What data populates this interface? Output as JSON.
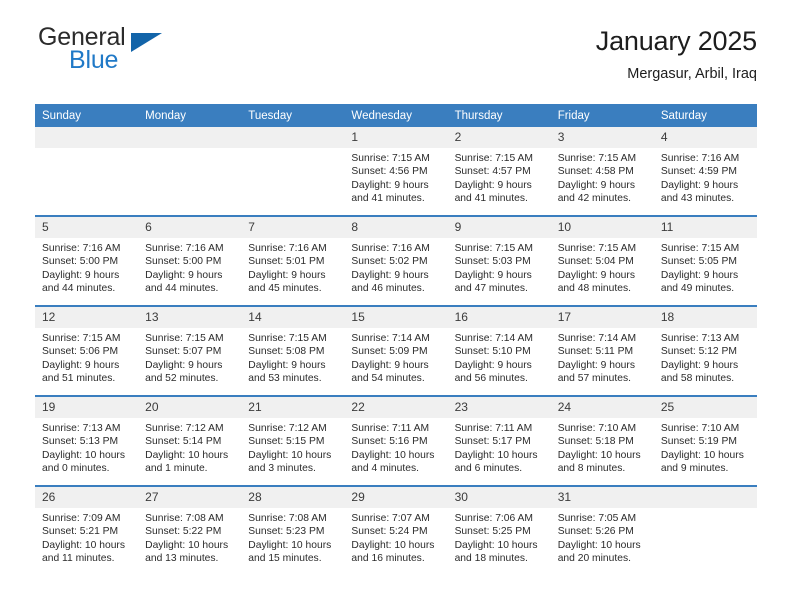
{
  "brand": {
    "name_top": "General",
    "name_bottom": "Blue"
  },
  "header": {
    "title": "January 2025",
    "location": "Mergasur, Arbil, Iraq"
  },
  "colors": {
    "header_blue": "#3a7ebf",
    "brand_blue": "#2079c7",
    "triangle_blue": "#1264a9",
    "daynum_band": "#f0f0f0"
  },
  "weekdays": [
    "Sunday",
    "Monday",
    "Tuesday",
    "Wednesday",
    "Thursday",
    "Friday",
    "Saturday"
  ],
  "weeks": [
    [
      {
        "day": "",
        "empty": true
      },
      {
        "day": "",
        "empty": true
      },
      {
        "day": "",
        "empty": true
      },
      {
        "day": "1",
        "sunrise": "Sunrise: 7:15 AM",
        "sunset": "Sunset: 4:56 PM",
        "daylight1": "Daylight: 9 hours",
        "daylight2": "and 41 minutes."
      },
      {
        "day": "2",
        "sunrise": "Sunrise: 7:15 AM",
        "sunset": "Sunset: 4:57 PM",
        "daylight1": "Daylight: 9 hours",
        "daylight2": "and 41 minutes."
      },
      {
        "day": "3",
        "sunrise": "Sunrise: 7:15 AM",
        "sunset": "Sunset: 4:58 PM",
        "daylight1": "Daylight: 9 hours",
        "daylight2": "and 42 minutes."
      },
      {
        "day": "4",
        "sunrise": "Sunrise: 7:16 AM",
        "sunset": "Sunset: 4:59 PM",
        "daylight1": "Daylight: 9 hours",
        "daylight2": "and 43 minutes."
      }
    ],
    [
      {
        "day": "5",
        "sunrise": "Sunrise: 7:16 AM",
        "sunset": "Sunset: 5:00 PM",
        "daylight1": "Daylight: 9 hours",
        "daylight2": "and 44 minutes."
      },
      {
        "day": "6",
        "sunrise": "Sunrise: 7:16 AM",
        "sunset": "Sunset: 5:00 PM",
        "daylight1": "Daylight: 9 hours",
        "daylight2": "and 44 minutes."
      },
      {
        "day": "7",
        "sunrise": "Sunrise: 7:16 AM",
        "sunset": "Sunset: 5:01 PM",
        "daylight1": "Daylight: 9 hours",
        "daylight2": "and 45 minutes."
      },
      {
        "day": "8",
        "sunrise": "Sunrise: 7:16 AM",
        "sunset": "Sunset: 5:02 PM",
        "daylight1": "Daylight: 9 hours",
        "daylight2": "and 46 minutes."
      },
      {
        "day": "9",
        "sunrise": "Sunrise: 7:15 AM",
        "sunset": "Sunset: 5:03 PM",
        "daylight1": "Daylight: 9 hours",
        "daylight2": "and 47 minutes."
      },
      {
        "day": "10",
        "sunrise": "Sunrise: 7:15 AM",
        "sunset": "Sunset: 5:04 PM",
        "daylight1": "Daylight: 9 hours",
        "daylight2": "and 48 minutes."
      },
      {
        "day": "11",
        "sunrise": "Sunrise: 7:15 AM",
        "sunset": "Sunset: 5:05 PM",
        "daylight1": "Daylight: 9 hours",
        "daylight2": "and 49 minutes."
      }
    ],
    [
      {
        "day": "12",
        "sunrise": "Sunrise: 7:15 AM",
        "sunset": "Sunset: 5:06 PM",
        "daylight1": "Daylight: 9 hours",
        "daylight2": "and 51 minutes."
      },
      {
        "day": "13",
        "sunrise": "Sunrise: 7:15 AM",
        "sunset": "Sunset: 5:07 PM",
        "daylight1": "Daylight: 9 hours",
        "daylight2": "and 52 minutes."
      },
      {
        "day": "14",
        "sunrise": "Sunrise: 7:15 AM",
        "sunset": "Sunset: 5:08 PM",
        "daylight1": "Daylight: 9 hours",
        "daylight2": "and 53 minutes."
      },
      {
        "day": "15",
        "sunrise": "Sunrise: 7:14 AM",
        "sunset": "Sunset: 5:09 PM",
        "daylight1": "Daylight: 9 hours",
        "daylight2": "and 54 minutes."
      },
      {
        "day": "16",
        "sunrise": "Sunrise: 7:14 AM",
        "sunset": "Sunset: 5:10 PM",
        "daylight1": "Daylight: 9 hours",
        "daylight2": "and 56 minutes."
      },
      {
        "day": "17",
        "sunrise": "Sunrise: 7:14 AM",
        "sunset": "Sunset: 5:11 PM",
        "daylight1": "Daylight: 9 hours",
        "daylight2": "and 57 minutes."
      },
      {
        "day": "18",
        "sunrise": "Sunrise: 7:13 AM",
        "sunset": "Sunset: 5:12 PM",
        "daylight1": "Daylight: 9 hours",
        "daylight2": "and 58 minutes."
      }
    ],
    [
      {
        "day": "19",
        "sunrise": "Sunrise: 7:13 AM",
        "sunset": "Sunset: 5:13 PM",
        "daylight1": "Daylight: 10 hours",
        "daylight2": "and 0 minutes."
      },
      {
        "day": "20",
        "sunrise": "Sunrise: 7:12 AM",
        "sunset": "Sunset: 5:14 PM",
        "daylight1": "Daylight: 10 hours",
        "daylight2": "and 1 minute."
      },
      {
        "day": "21",
        "sunrise": "Sunrise: 7:12 AM",
        "sunset": "Sunset: 5:15 PM",
        "daylight1": "Daylight: 10 hours",
        "daylight2": "and 3 minutes."
      },
      {
        "day": "22",
        "sunrise": "Sunrise: 7:11 AM",
        "sunset": "Sunset: 5:16 PM",
        "daylight1": "Daylight: 10 hours",
        "daylight2": "and 4 minutes."
      },
      {
        "day": "23",
        "sunrise": "Sunrise: 7:11 AM",
        "sunset": "Sunset: 5:17 PM",
        "daylight1": "Daylight: 10 hours",
        "daylight2": "and 6 minutes."
      },
      {
        "day": "24",
        "sunrise": "Sunrise: 7:10 AM",
        "sunset": "Sunset: 5:18 PM",
        "daylight1": "Daylight: 10 hours",
        "daylight2": "and 8 minutes."
      },
      {
        "day": "25",
        "sunrise": "Sunrise: 7:10 AM",
        "sunset": "Sunset: 5:19 PM",
        "daylight1": "Daylight: 10 hours",
        "daylight2": "and 9 minutes."
      }
    ],
    [
      {
        "day": "26",
        "sunrise": "Sunrise: 7:09 AM",
        "sunset": "Sunset: 5:21 PM",
        "daylight1": "Daylight: 10 hours",
        "daylight2": "and 11 minutes."
      },
      {
        "day": "27",
        "sunrise": "Sunrise: 7:08 AM",
        "sunset": "Sunset: 5:22 PM",
        "daylight1": "Daylight: 10 hours",
        "daylight2": "and 13 minutes."
      },
      {
        "day": "28",
        "sunrise": "Sunrise: 7:08 AM",
        "sunset": "Sunset: 5:23 PM",
        "daylight1": "Daylight: 10 hours",
        "daylight2": "and 15 minutes."
      },
      {
        "day": "29",
        "sunrise": "Sunrise: 7:07 AM",
        "sunset": "Sunset: 5:24 PM",
        "daylight1": "Daylight: 10 hours",
        "daylight2": "and 16 minutes."
      },
      {
        "day": "30",
        "sunrise": "Sunrise: 7:06 AM",
        "sunset": "Sunset: 5:25 PM",
        "daylight1": "Daylight: 10 hours",
        "daylight2": "and 18 minutes."
      },
      {
        "day": "31",
        "sunrise": "Sunrise: 7:05 AM",
        "sunset": "Sunset: 5:26 PM",
        "daylight1": "Daylight: 10 hours",
        "daylight2": "and 20 minutes."
      },
      {
        "day": "",
        "empty": true
      }
    ]
  ]
}
